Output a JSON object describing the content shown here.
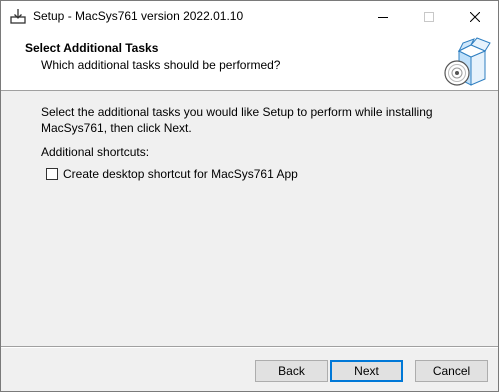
{
  "window": {
    "title": "Setup - MacSys761 version 2022.01.10",
    "icon": "installer-download-icon",
    "controls": [
      "minimize-icon",
      "maximize-icon",
      "close-icon"
    ]
  },
  "header": {
    "title": "Select Additional Tasks",
    "subtitle": "Which additional tasks should be performed?",
    "image": "box-with-disc-icon"
  },
  "body": {
    "intro": "Select the additional tasks you would like Setup to perform while installing MacSys761, then click Next.",
    "group_label": "Additional shortcuts:",
    "tasks": [
      {
        "label": "Create desktop shortcut for MacSys761 App",
        "checked": false
      }
    ]
  },
  "footer": {
    "back_label": "Back",
    "next_label": "Next",
    "cancel_label": "Cancel"
  },
  "colors": {
    "accent": "#0078d7",
    "header_background": "#ffffff",
    "window_background": "#f0f0f0",
    "button_face": "#e1e1e1"
  }
}
